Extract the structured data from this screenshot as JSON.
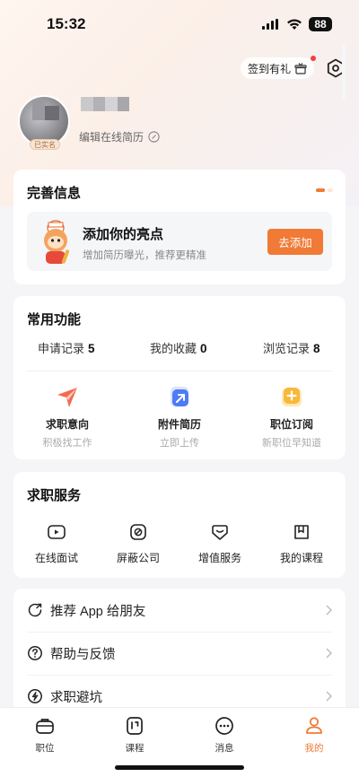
{
  "status_bar": {
    "time": "15:32",
    "battery": "88"
  },
  "header": {
    "checkin_label": "签到有礼"
  },
  "profile": {
    "verified_badge": "已实名",
    "edit_resume_label": "编辑在线简历"
  },
  "complete_info": {
    "title": "完善信息",
    "highlight_title": "添加你的亮点",
    "highlight_subtitle": "增加简历曝光，推荐更精准",
    "add_button": "去添加"
  },
  "common_functions": {
    "title": "常用功能",
    "stats": [
      {
        "label": "申请记录",
        "value": "5"
      },
      {
        "label": "我的收藏",
        "value": "0"
      },
      {
        "label": "浏览记录",
        "value": "8"
      }
    ],
    "items": [
      {
        "label": "求职意向",
        "sub": "积极找工作",
        "icon": "paper-plane-icon"
      },
      {
        "label": "附件简历",
        "sub": "立即上传",
        "icon": "upload-file-icon"
      },
      {
        "label": "职位订阅",
        "sub": "新职位早知道",
        "icon": "subscribe-plus-icon"
      }
    ]
  },
  "job_services": {
    "title": "求职服务",
    "items": [
      {
        "label": "在线面试",
        "icon": "video-icon"
      },
      {
        "label": "屏蔽公司",
        "icon": "block-icon"
      },
      {
        "label": "增值服务",
        "icon": "diamond-icon"
      },
      {
        "label": "我的课程",
        "icon": "course-icon"
      }
    ]
  },
  "menu_list": [
    {
      "label": "推荐 App 给朋友",
      "icon": "share-icon"
    },
    {
      "label": "帮助与反馈",
      "icon": "help-icon"
    },
    {
      "label": "求职避坑",
      "icon": "shield-icon"
    }
  ],
  "tab_bar": {
    "tabs": [
      {
        "label": "职位",
        "icon": "briefcase-icon"
      },
      {
        "label": "课程",
        "icon": "book-icon"
      },
      {
        "label": "消息",
        "icon": "chat-icon"
      },
      {
        "label": "我的",
        "icon": "person-icon"
      }
    ],
    "active_index": 3
  },
  "colors": {
    "accent": "#f07a36",
    "accent_light": "#fde6d6",
    "background": "#f5f5f7"
  }
}
